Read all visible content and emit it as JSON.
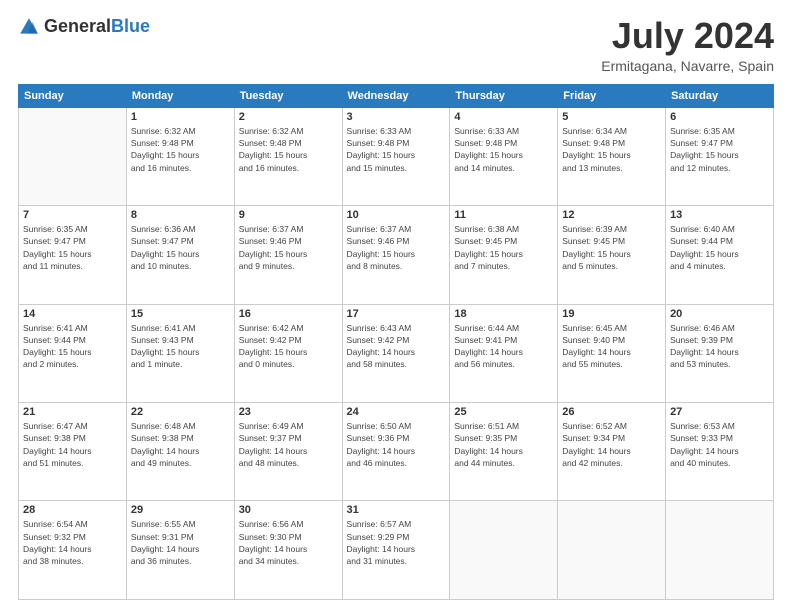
{
  "logo": {
    "general": "General",
    "blue": "Blue"
  },
  "header": {
    "month_year": "July 2024",
    "location": "Ermitagana, Navarre, Spain"
  },
  "weekdays": [
    "Sunday",
    "Monday",
    "Tuesday",
    "Wednesday",
    "Thursday",
    "Friday",
    "Saturday"
  ],
  "weeks": [
    [
      {
        "day": null,
        "info": null
      },
      {
        "day": "1",
        "info": "Sunrise: 6:32 AM\nSunset: 9:48 PM\nDaylight: 15 hours\nand 16 minutes."
      },
      {
        "day": "2",
        "info": "Sunrise: 6:32 AM\nSunset: 9:48 PM\nDaylight: 15 hours\nand 16 minutes."
      },
      {
        "day": "3",
        "info": "Sunrise: 6:33 AM\nSunset: 9:48 PM\nDaylight: 15 hours\nand 15 minutes."
      },
      {
        "day": "4",
        "info": "Sunrise: 6:33 AM\nSunset: 9:48 PM\nDaylight: 15 hours\nand 14 minutes."
      },
      {
        "day": "5",
        "info": "Sunrise: 6:34 AM\nSunset: 9:48 PM\nDaylight: 15 hours\nand 13 minutes."
      },
      {
        "day": "6",
        "info": "Sunrise: 6:35 AM\nSunset: 9:47 PM\nDaylight: 15 hours\nand 12 minutes."
      }
    ],
    [
      {
        "day": "7",
        "info": "Sunrise: 6:35 AM\nSunset: 9:47 PM\nDaylight: 15 hours\nand 11 minutes."
      },
      {
        "day": "8",
        "info": "Sunrise: 6:36 AM\nSunset: 9:47 PM\nDaylight: 15 hours\nand 10 minutes."
      },
      {
        "day": "9",
        "info": "Sunrise: 6:37 AM\nSunset: 9:46 PM\nDaylight: 15 hours\nand 9 minutes."
      },
      {
        "day": "10",
        "info": "Sunrise: 6:37 AM\nSunset: 9:46 PM\nDaylight: 15 hours\nand 8 minutes."
      },
      {
        "day": "11",
        "info": "Sunrise: 6:38 AM\nSunset: 9:45 PM\nDaylight: 15 hours\nand 7 minutes."
      },
      {
        "day": "12",
        "info": "Sunrise: 6:39 AM\nSunset: 9:45 PM\nDaylight: 15 hours\nand 5 minutes."
      },
      {
        "day": "13",
        "info": "Sunrise: 6:40 AM\nSunset: 9:44 PM\nDaylight: 15 hours\nand 4 minutes."
      }
    ],
    [
      {
        "day": "14",
        "info": "Sunrise: 6:41 AM\nSunset: 9:44 PM\nDaylight: 15 hours\nand 2 minutes."
      },
      {
        "day": "15",
        "info": "Sunrise: 6:41 AM\nSunset: 9:43 PM\nDaylight: 15 hours\nand 1 minute."
      },
      {
        "day": "16",
        "info": "Sunrise: 6:42 AM\nSunset: 9:42 PM\nDaylight: 15 hours\nand 0 minutes."
      },
      {
        "day": "17",
        "info": "Sunrise: 6:43 AM\nSunset: 9:42 PM\nDaylight: 14 hours\nand 58 minutes."
      },
      {
        "day": "18",
        "info": "Sunrise: 6:44 AM\nSunset: 9:41 PM\nDaylight: 14 hours\nand 56 minutes."
      },
      {
        "day": "19",
        "info": "Sunrise: 6:45 AM\nSunset: 9:40 PM\nDaylight: 14 hours\nand 55 minutes."
      },
      {
        "day": "20",
        "info": "Sunrise: 6:46 AM\nSunset: 9:39 PM\nDaylight: 14 hours\nand 53 minutes."
      }
    ],
    [
      {
        "day": "21",
        "info": "Sunrise: 6:47 AM\nSunset: 9:38 PM\nDaylight: 14 hours\nand 51 minutes."
      },
      {
        "day": "22",
        "info": "Sunrise: 6:48 AM\nSunset: 9:38 PM\nDaylight: 14 hours\nand 49 minutes."
      },
      {
        "day": "23",
        "info": "Sunrise: 6:49 AM\nSunset: 9:37 PM\nDaylight: 14 hours\nand 48 minutes."
      },
      {
        "day": "24",
        "info": "Sunrise: 6:50 AM\nSunset: 9:36 PM\nDaylight: 14 hours\nand 46 minutes."
      },
      {
        "day": "25",
        "info": "Sunrise: 6:51 AM\nSunset: 9:35 PM\nDaylight: 14 hours\nand 44 minutes."
      },
      {
        "day": "26",
        "info": "Sunrise: 6:52 AM\nSunset: 9:34 PM\nDaylight: 14 hours\nand 42 minutes."
      },
      {
        "day": "27",
        "info": "Sunrise: 6:53 AM\nSunset: 9:33 PM\nDaylight: 14 hours\nand 40 minutes."
      }
    ],
    [
      {
        "day": "28",
        "info": "Sunrise: 6:54 AM\nSunset: 9:32 PM\nDaylight: 14 hours\nand 38 minutes."
      },
      {
        "day": "29",
        "info": "Sunrise: 6:55 AM\nSunset: 9:31 PM\nDaylight: 14 hours\nand 36 minutes."
      },
      {
        "day": "30",
        "info": "Sunrise: 6:56 AM\nSunset: 9:30 PM\nDaylight: 14 hours\nand 34 minutes."
      },
      {
        "day": "31",
        "info": "Sunrise: 6:57 AM\nSunset: 9:29 PM\nDaylight: 14 hours\nand 31 minutes."
      },
      {
        "day": null,
        "info": null
      },
      {
        "day": null,
        "info": null
      },
      {
        "day": null,
        "info": null
      }
    ]
  ]
}
